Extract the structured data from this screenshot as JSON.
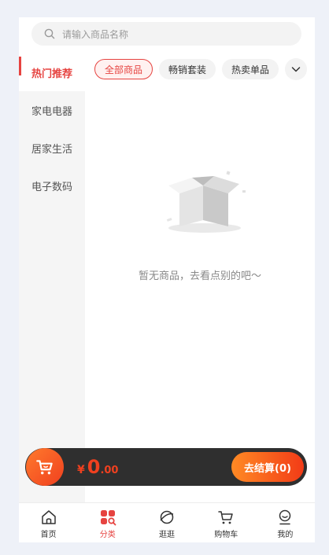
{
  "search": {
    "placeholder": "请输入商品名称"
  },
  "sidebar": {
    "items": [
      {
        "label": "热门推荐",
        "active": true
      },
      {
        "label": "家电电器",
        "active": false
      },
      {
        "label": "居家生活",
        "active": false
      },
      {
        "label": "电子数码",
        "active": false
      }
    ]
  },
  "filters": {
    "chips": [
      {
        "label": "全部商品",
        "active": true
      },
      {
        "label": "畅销套装",
        "active": false
      },
      {
        "label": "热卖单品",
        "active": false
      }
    ],
    "more_icon": "chevron-down-icon"
  },
  "empty": {
    "message": "暂无商品，去看点别的吧～",
    "icon": "empty-box-illustration"
  },
  "cart": {
    "currency": "¥",
    "amount_integer": "0",
    "amount_decimal": ".00",
    "checkout_label": "去结算(0)",
    "icon": "cart-icon"
  },
  "tabbar": {
    "items": [
      {
        "label": "首页",
        "icon": "home-icon"
      },
      {
        "label": "分类",
        "icon": "category-icon",
        "active": true
      },
      {
        "label": "逛逛",
        "icon": "planet-icon"
      },
      {
        "label": "购物车",
        "icon": "cart-icon"
      },
      {
        "label": "我的",
        "icon": "user-icon"
      }
    ]
  },
  "colors": {
    "accent": "#e64340",
    "checkout_start": "#ff8a24",
    "checkout_end": "#f23b17",
    "cartbar": "#2f2f2f"
  }
}
